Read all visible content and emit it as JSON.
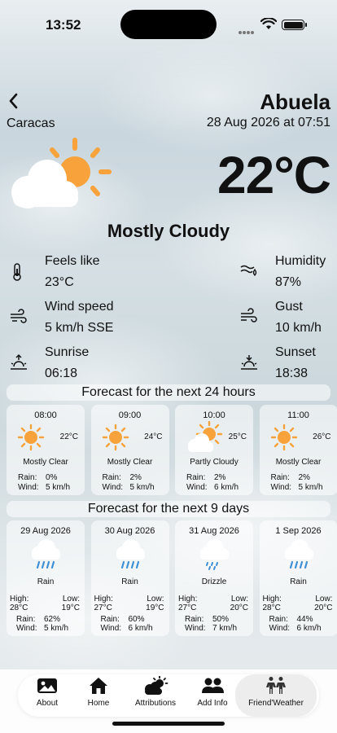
{
  "status_bar": {
    "time": "13:52"
  },
  "header": {
    "city": "Caracas",
    "location": "Abuela",
    "datetime": "28 Aug 2026 at 07:51",
    "temperature": "22°C",
    "condition": "Mostly Cloudy",
    "icon": "cloud-sun-icon"
  },
  "details": {
    "feels_like": {
      "label": "Feels like",
      "value": "23°C",
      "icon": "thermometer-icon"
    },
    "humidity": {
      "label": "Humidity",
      "value": "87%",
      "icon": "humidity-icon"
    },
    "wind_speed": {
      "label": "Wind speed",
      "value": "5 km/h  SSE",
      "icon": "wind-icon"
    },
    "gust": {
      "label": "Gust",
      "value": "10 km/h",
      "icon": "gust-icon"
    },
    "sunrise": {
      "label": "Sunrise",
      "value": "06:18",
      "icon": "sunrise-icon"
    },
    "sunset": {
      "label": "Sunset",
      "value": "18:38",
      "icon": "sunset-icon"
    }
  },
  "hourly": {
    "title": "Forecast for the next 24 hours",
    "rain_label": "Rain:",
    "wind_label": "Wind:",
    "items": [
      {
        "time": "08:00",
        "temp": "22°C",
        "desc": "Mostly Clear",
        "rain": "0%",
        "wind": "5 km/h",
        "icon": "sun-icon"
      },
      {
        "time": "09:00",
        "temp": "24°C",
        "desc": "Mostly Clear",
        "rain": "2%",
        "wind": "5 km/h",
        "icon": "sun-icon"
      },
      {
        "time": "10:00",
        "temp": "25°C",
        "desc": "Partly Cloudy",
        "rain": "2%",
        "wind": "6 km/h",
        "icon": "cloud-sun-icon"
      },
      {
        "time": "11:00",
        "temp": "26°C",
        "desc": "Mostly Clear",
        "rain": "2%",
        "wind": "5 km/h",
        "icon": "sun-icon"
      }
    ]
  },
  "daily": {
    "title": "Forecast for the next 9 days",
    "high_label": "High:",
    "low_label": "Low:",
    "rain_label": "Rain:",
    "wind_label": "Wind:",
    "items": [
      {
        "date": "29 Aug 2026",
        "desc": "Rain",
        "high": "28°C",
        "low": "19°C",
        "rain": "62%",
        "wind": "5 km/h",
        "icon": "rain-icon"
      },
      {
        "date": "30 Aug 2026",
        "desc": "Rain",
        "high": "27°C",
        "low": "19°C",
        "rain": "60%",
        "wind": "6 km/h",
        "icon": "rain-icon"
      },
      {
        "date": "31 Aug 2026",
        "desc": "Drizzle",
        "high": "27°C",
        "low": "20°C",
        "rain": "50%",
        "wind": "7 km/h",
        "icon": "drizzle-icon"
      },
      {
        "date": "1 Sep 2026",
        "desc": "Rain",
        "high": "28°C",
        "low": "20°C",
        "rain": "44%",
        "wind": "6 km/h",
        "icon": "rain-icon"
      }
    ]
  },
  "tabs": [
    {
      "label": "About",
      "icon": "photo-icon"
    },
    {
      "label": "Home",
      "icon": "home-icon"
    },
    {
      "label": "Attributions",
      "icon": "cloud-sun-icon"
    },
    {
      "label": "Add Info",
      "icon": "people-icon"
    },
    {
      "label": "Friend'Weather",
      "icon": "friends-icon",
      "active": true
    }
  ],
  "colors": {
    "sun": "#f7a23a",
    "cloud": "#ffffff",
    "accent_text": "#111111"
  }
}
